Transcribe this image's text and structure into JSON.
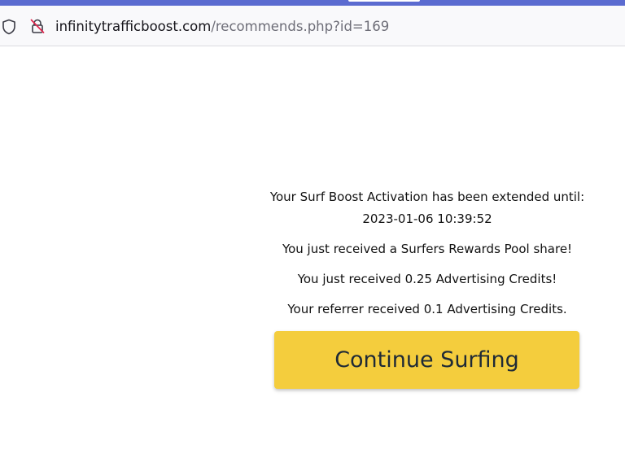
{
  "browser": {
    "url_host": "infinitytrafficboost.com",
    "url_path": "/recommends.php?id=169"
  },
  "message": {
    "line1": "Your Surf Boost Activation has been extended until:",
    "expiry_date": "2023-01-06 10:39:52",
    "pool_share": "You just received a Surfers Rewards Pool share!",
    "credits_received": "You just received 0.25 Advertising Credits!",
    "referrer_credits": "Your referrer received 0.1 Advertising Credits."
  },
  "continue_button": {
    "label": "Continue Surfing"
  },
  "colors": {
    "button_bg": "#f4cd3d",
    "button_text": "#1f2a36",
    "top_strip": "#5b6bd0"
  },
  "icons": {
    "tracking_protection": "shield-icon",
    "connection": "insecure-lock-icon"
  }
}
